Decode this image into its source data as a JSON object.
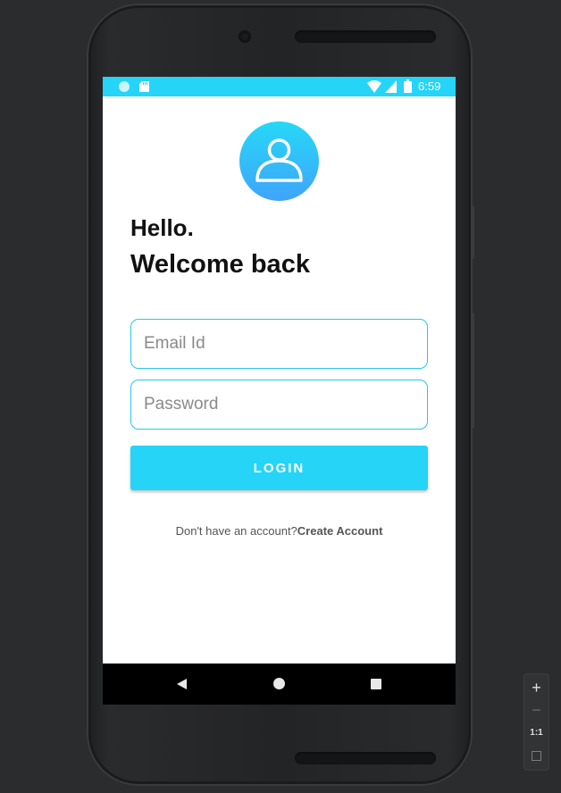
{
  "status_bar": {
    "time": "6:59",
    "color": "#26d4f7"
  },
  "icons": {
    "avatar": "user-icon",
    "notification": "circle-icon",
    "sd_card": "sd-card-icon",
    "wifi": "wifi-icon",
    "signal": "signal-icon",
    "battery": "battery-icon"
  },
  "login": {
    "greeting": "Hello.",
    "subtitle": "Welcome back",
    "email_placeholder": "Email Id",
    "password_placeholder": "Password",
    "login_label": "LOGIN",
    "signup_prompt": "Don't have an account?",
    "signup_link": "Create Account"
  },
  "colors": {
    "accent": "#26d4f7",
    "field_border": "#26c7ea",
    "avatar_top": "#26d8f6",
    "avatar_bottom": "#3fa4fb"
  },
  "zoom_controls": {
    "zoom_in": "+",
    "zoom_out": "−",
    "actual_size": "1:1"
  }
}
